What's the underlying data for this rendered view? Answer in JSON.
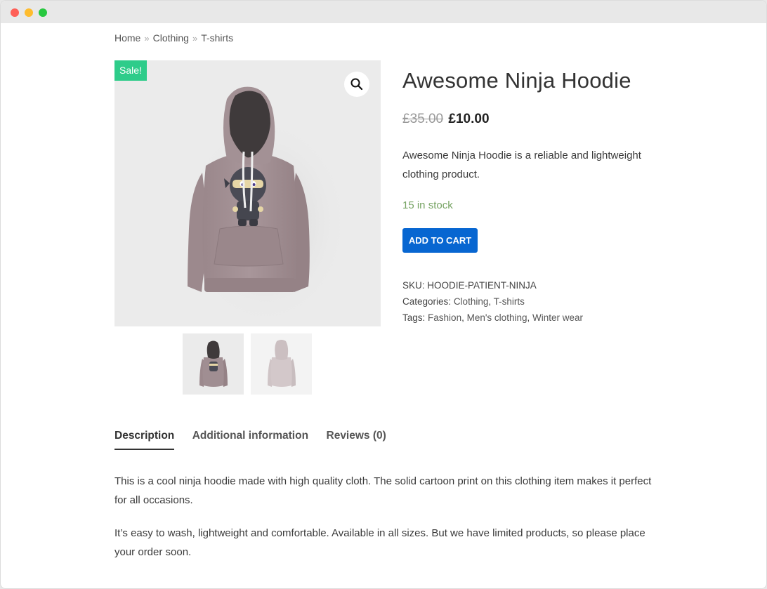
{
  "window": {
    "controls": [
      "close",
      "minimize",
      "maximize"
    ]
  },
  "breadcrumb": {
    "items": [
      {
        "label": "Home"
      },
      {
        "label": "Clothing"
      },
      {
        "label": "T-shirts"
      }
    ],
    "separator": "»"
  },
  "gallery": {
    "sale_badge": "Sale!",
    "zoom_icon": "magnifier-icon",
    "thumbnails": [
      {
        "label": "front view",
        "active": true
      },
      {
        "label": "back view",
        "active": false
      }
    ]
  },
  "product": {
    "title": "Awesome Ninja Hoodie",
    "regular_price": "£35.00",
    "sale_price": "£10.00",
    "short_description": "Awesome Ninja Hoodie is a reliable and lightweight clothing product.",
    "stock": "15 in stock",
    "add_to_cart_label": "ADD TO CART",
    "meta": {
      "sku_label": "SKU:",
      "sku": "HOODIE-PATIENT-NINJA",
      "categories_label": "Categories:",
      "categories": [
        "Clothing",
        "T-shirts"
      ],
      "tags_label": "Tags:",
      "tags": [
        "Fashion",
        "Men's clothing",
        "Winter wear"
      ]
    }
  },
  "tabs": [
    {
      "label": "Description",
      "active": true
    },
    {
      "label": "Additional information",
      "active": false
    },
    {
      "label": "Reviews (0)",
      "active": false
    }
  ],
  "description": {
    "paragraphs": [
      "This is a cool ninja hoodie made with high quality cloth. The solid cartoon print on this clothing item makes it perfect for all occasions.",
      "It’s easy to wash, lightweight and comfortable. Available in all sizes. But we have limited products, so please place your order soon."
    ]
  },
  "colors": {
    "sale_badge": "#2ecc8a",
    "button": "#0766d1",
    "stock": "#77a464",
    "hoodie": "#a08e92"
  }
}
